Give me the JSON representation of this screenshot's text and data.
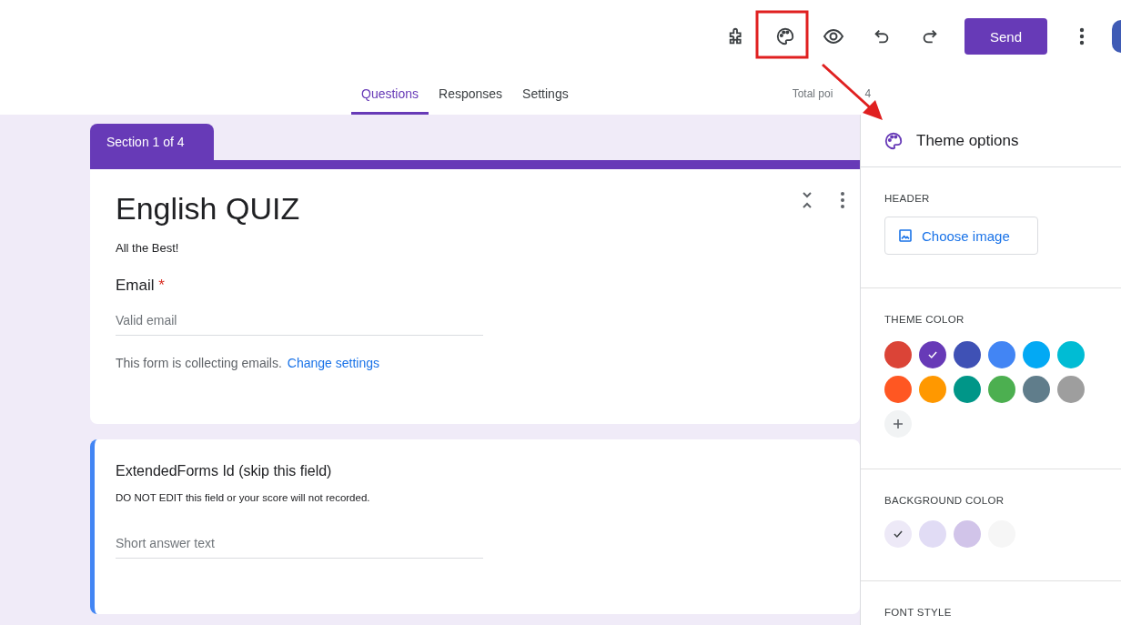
{
  "toolbar": {
    "send_label": "Send"
  },
  "tabs": [
    {
      "label": "Questions",
      "selected": true
    },
    {
      "label": "Responses",
      "selected": false
    },
    {
      "label": "Settings",
      "selected": false
    }
  ],
  "total_points": {
    "label": "Total poi",
    "value": "4"
  },
  "section_tab": "Section 1 of 4",
  "form": {
    "title": "English QUIZ",
    "description": "All the Best!",
    "email": {
      "label": "Email",
      "required_mark": "*",
      "placeholder": "Valid email",
      "note": "This form is collecting emails.",
      "link": "Change settings"
    }
  },
  "question": {
    "title": "ExtendedForms Id (skip this field)",
    "description": "DO NOT EDIT this field or your score will not recorded.",
    "placeholder": "Short answer text"
  },
  "theme_panel": {
    "title": "Theme options",
    "header_label": "HEADER",
    "choose_image": "Choose image",
    "theme_color_label": "THEME COLOR",
    "theme_colors": [
      {
        "color": "#db4437",
        "selected": false
      },
      {
        "color": "#673ab7",
        "selected": true
      },
      {
        "color": "#3f51b5",
        "selected": false
      },
      {
        "color": "#4285f4",
        "selected": false
      },
      {
        "color": "#03a9f4",
        "selected": false
      },
      {
        "color": "#00bcd4",
        "selected": false
      },
      {
        "color": "#ff5722",
        "selected": false
      },
      {
        "color": "#ff9800",
        "selected": false
      },
      {
        "color": "#009688",
        "selected": false
      },
      {
        "color": "#4caf50",
        "selected": false
      },
      {
        "color": "#607d8b",
        "selected": false
      },
      {
        "color": "#9e9e9e",
        "selected": false
      }
    ],
    "background_color_label": "BACKGROUND COLOR",
    "background_colors": [
      {
        "color": "#ede9f7",
        "selected": true
      },
      {
        "color": "#e1dcf5",
        "selected": false
      },
      {
        "color": "#d1c4e9",
        "selected": false
      },
      {
        "color": "#f6f6f6",
        "selected": false
      }
    ],
    "font_style_label": "FONT STYLE"
  }
}
